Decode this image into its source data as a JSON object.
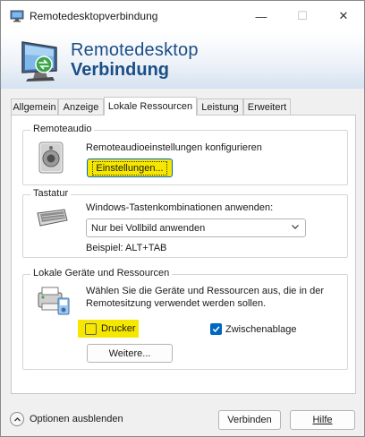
{
  "window": {
    "title": "Remotedesktopverbindung",
    "controls": {
      "minimize": "—",
      "maximize": "☐",
      "close": "✕"
    }
  },
  "banner": {
    "line1": "Remotedesktop",
    "line2": "Verbindung",
    "logo_icon": "remote-desktop-monitor-icon"
  },
  "tabs": [
    {
      "label": "Allgemein",
      "active": false
    },
    {
      "label": "Anzeige",
      "active": false
    },
    {
      "label": "Lokale Ressourcen",
      "active": true
    },
    {
      "label": "Leistung",
      "active": false
    },
    {
      "label": "Erweitert",
      "active": false
    }
  ],
  "remote_audio": {
    "legend": "Remoteaudio",
    "description": "Remoteaudioeinstellungen konfigurieren",
    "button_label": "Einstellungen...",
    "icon": "speaker-icon"
  },
  "keyboard": {
    "legend": "Tastatur",
    "description": "Windows-Tastenkombinationen anwenden:",
    "selected": "Nur bei Vollbild anwenden",
    "example": "Beispiel: ALT+TAB",
    "icon": "keyboard-icon"
  },
  "local_devices": {
    "legend": "Lokale Geräte und Ressourcen",
    "description_line1": "Wählen Sie die Geräte und Ressourcen aus, die in der",
    "description_line2": "Remotesitzung verwendet werden sollen.",
    "printer_label": "Drucker",
    "printer_checked": false,
    "clipboard_label": "Zwischenablage",
    "clipboard_checked": true,
    "more_button": "Weitere...",
    "icon": "devices-icon"
  },
  "footer": {
    "toggle_label": "Optionen ausblenden",
    "connect_button": "Verbinden",
    "help_button": "Hilfe"
  },
  "colors": {
    "highlight": "#f6e700",
    "accent": "#0067c0",
    "title_blue": "#1b4e86"
  }
}
